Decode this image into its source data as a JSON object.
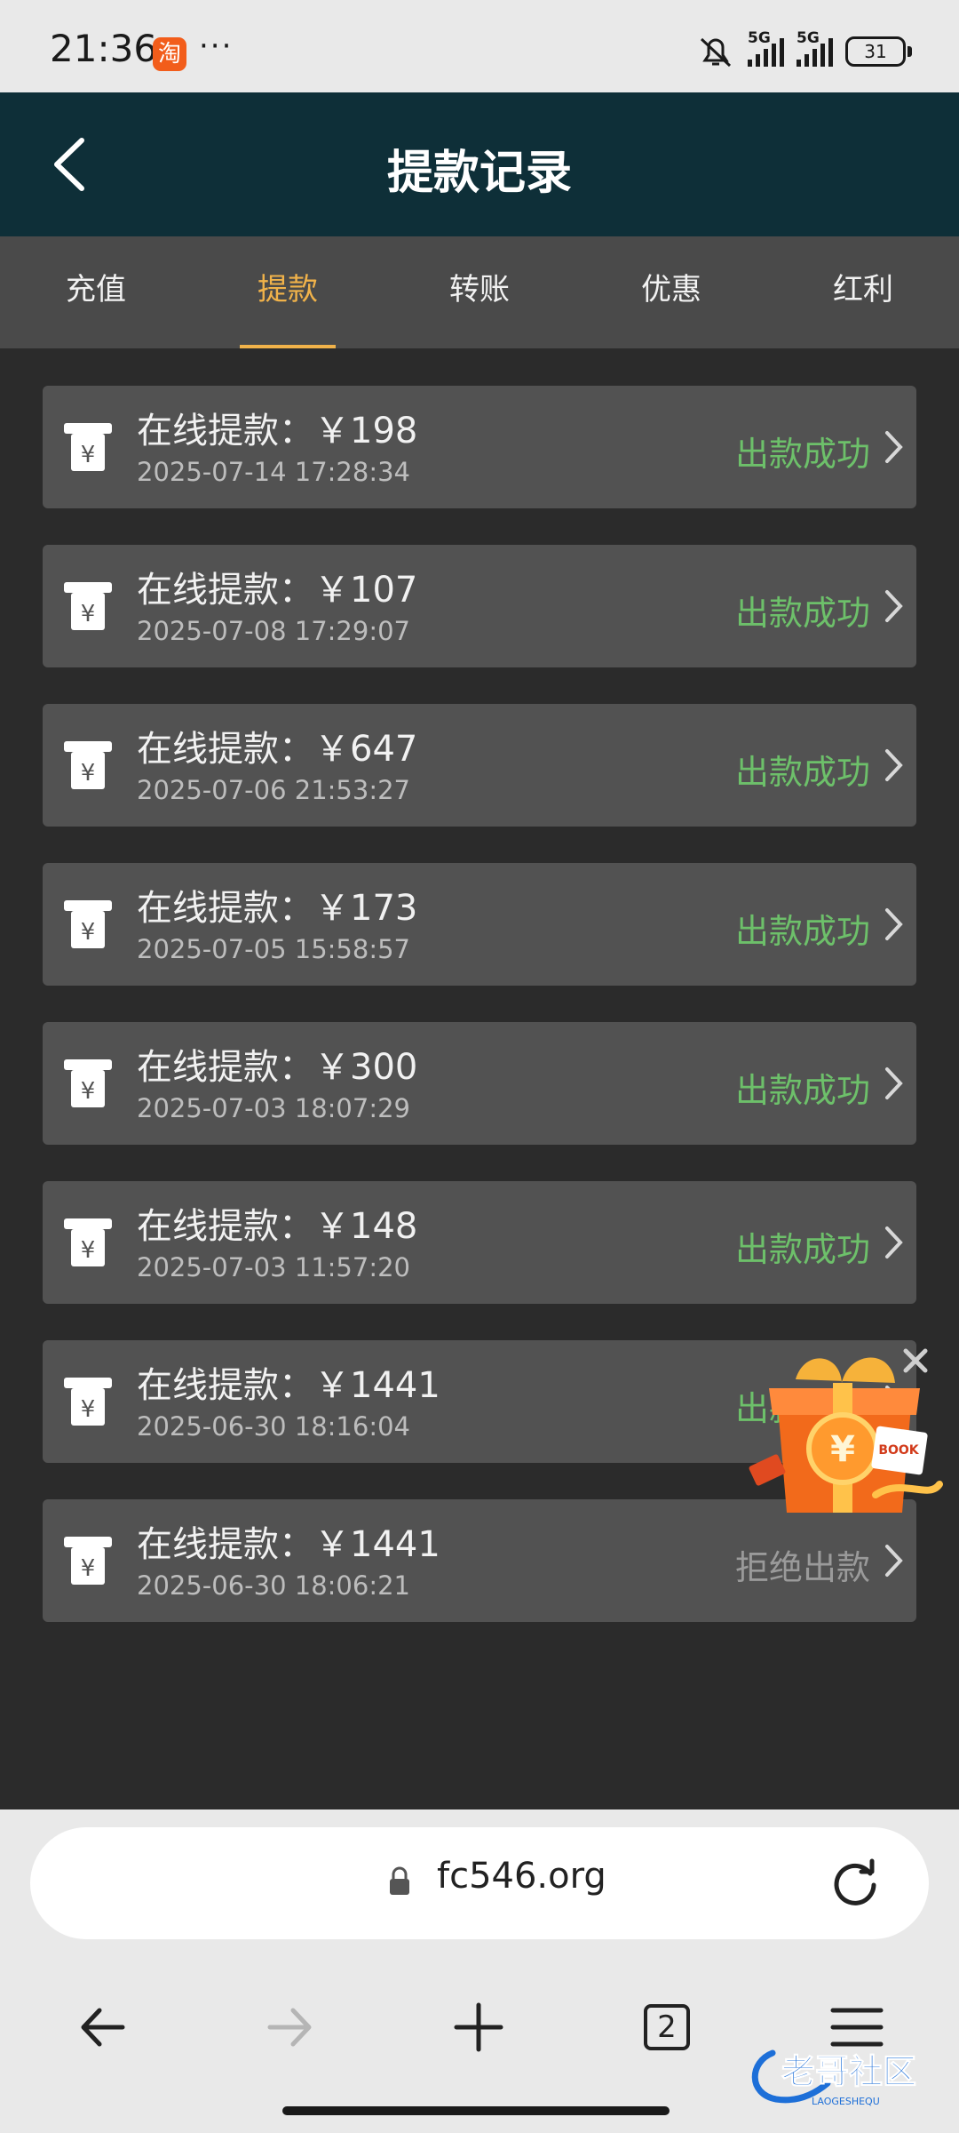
{
  "status_bar": {
    "time": "21:36",
    "app_badge": "淘",
    "more": "···",
    "network": "5G",
    "battery": "31"
  },
  "header": {
    "title": "提款记录"
  },
  "tabs": [
    {
      "label": "充值",
      "active": false
    },
    {
      "label": "提款",
      "active": true
    },
    {
      "label": "转账",
      "active": false
    },
    {
      "label": "优惠",
      "active": false
    },
    {
      "label": "红利",
      "active": false
    }
  ],
  "records": [
    {
      "amount_text": "在线提款：￥198",
      "time": "2025-07-14 17:28:34",
      "status": "出款成功"
    },
    {
      "amount_text": "在线提款：￥107",
      "time": "2025-07-08 17:29:07",
      "status": "出款成功"
    },
    {
      "amount_text": "在线提款：￥647",
      "time": "2025-07-06 21:53:27",
      "status": "出款成功"
    },
    {
      "amount_text": "在线提款：￥173",
      "time": "2025-07-05 15:58:57",
      "status": "出款成功"
    },
    {
      "amount_text": "在线提款：￥300",
      "time": "2025-07-03 18:07:29",
      "status": "出款成功"
    },
    {
      "amount_text": "在线提款：￥148",
      "time": "2025-07-03 11:57:20",
      "status": "出款成功"
    },
    {
      "amount_text": "在线提款：￥1441",
      "time": "2025-06-30 18:16:04",
      "status": "出款成功"
    },
    {
      "amount_text": "在线提款：￥1441",
      "time": "2025-06-30 18:06:21",
      "status": "拒绝出款"
    }
  ],
  "gift_popup": {
    "label": "BOOK"
  },
  "browser": {
    "url": "fc546.org",
    "tab_count": "2"
  },
  "watermark": {
    "text": "老哥社区",
    "subtext": "LAOGESHEQU"
  },
  "colors": {
    "header_bg": "#0e2f38",
    "accent": "#f0b24a",
    "success": "#6dc06a",
    "rejected": "#9a9a9a"
  }
}
